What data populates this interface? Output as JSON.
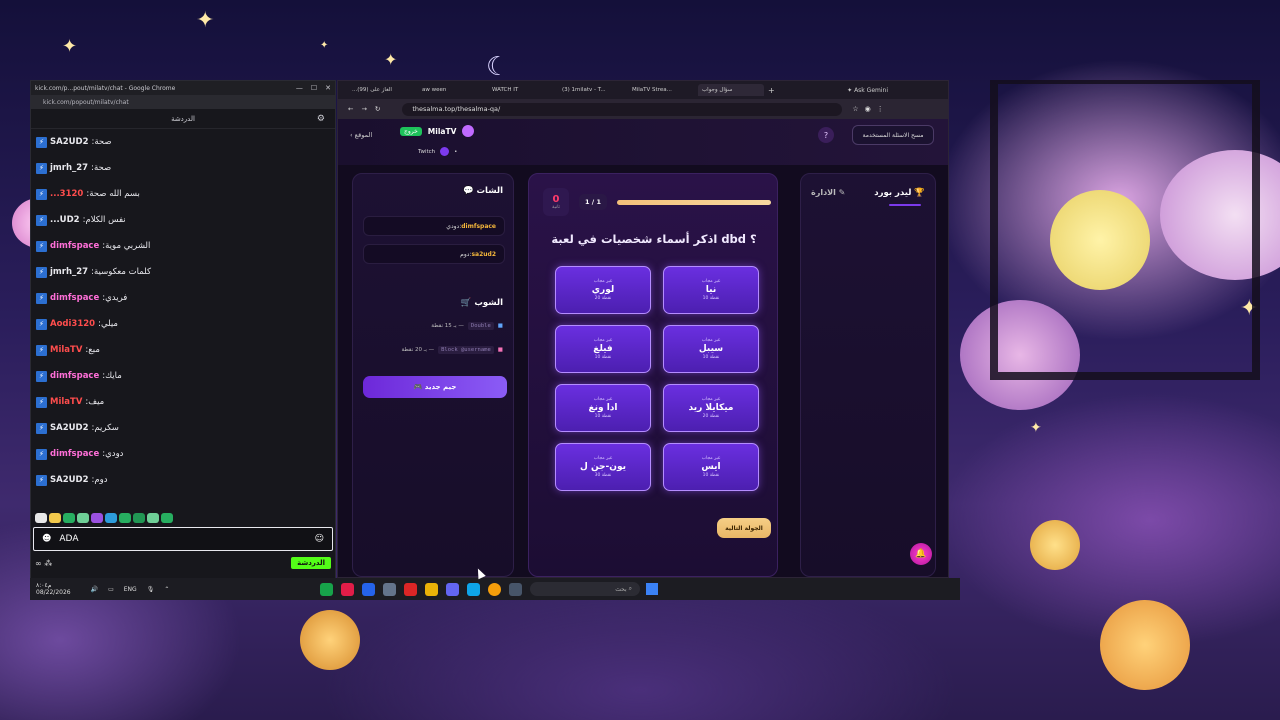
{
  "chat_window": {
    "title": "kick.com/p...pout/milatv/chat - Google Chrome",
    "address": "kick.com/popout/milatv/chat",
    "header": "الدردشة",
    "messages": [
      {
        "user": "SA2UD2",
        "text": "صحة",
        "color": "#e9e9ee"
      },
      {
        "user": "jmrh_27",
        "text": "صحة",
        "color": "#e9e9ee"
      },
      {
        "user": "...3120",
        "text": "بسم الله صحة",
        "color": "#ff4d4d"
      },
      {
        "user": "...UD2",
        "text": "نفس الكلام",
        "color": "#e9e9ee"
      },
      {
        "user": "dimfspace",
        "text": "الشربي موية",
        "color": "#ff6fd8"
      },
      {
        "user": "jmrh_27",
        "text": "كلمات معكوسية",
        "color": "#e9e9ee"
      },
      {
        "user": "dimfspace",
        "text": "فريدي",
        "color": "#ff6fd8"
      },
      {
        "user": "Aodi3120",
        "text": "ميلي",
        "color": "#ff4d4d"
      },
      {
        "user": "MilaTV",
        "text": "مبع",
        "color": "#ff4d4d"
      },
      {
        "user": "dimfspace",
        "text": "مايك",
        "color": "#ff6fd8"
      },
      {
        "user": "MilaTV",
        "text": "ميف",
        "color": "#ff4d4d"
      },
      {
        "user": "SA2UD2",
        "text": "سكريم",
        "color": "#e9e9ee"
      },
      {
        "user": "dimfspace",
        "text": "دودي",
        "color": "#ff6fd8"
      },
      {
        "user": "SA2UD2",
        "text": "دوم",
        "color": "#e9e9ee"
      }
    ],
    "input_value": "ADA",
    "send_label": "الدردشة",
    "bottom_left": "∞ ⁂"
  },
  "taskbar": {
    "time": "م٨:٠٤",
    "date": "08/22/2026",
    "lang": "ENG",
    "search_placeholder": "بحث"
  },
  "browser": {
    "tabs": [
      {
        "label": "...(99) الغاز على",
        "active": false
      },
      {
        "label": "aw ween",
        "active": false
      },
      {
        "label": "WATCH IT",
        "active": false
      },
      {
        "label": "(3) 1milatv - T...",
        "active": false
      },
      {
        "label": "MilaTV Strea...",
        "active": false
      },
      {
        "label": "سؤال وجواب",
        "active": true
      }
    ],
    "gemini": "Ask Gemini",
    "url": "thesalma.top/thesalma-qa/"
  },
  "site": {
    "clear_btn": "مسح الاسئلة المستخدمة",
    "help": "?",
    "logout": "خروج",
    "username": "MilaTV",
    "twitch": "Twitch",
    "back_link": "الموقع",
    "chat_title": "الشات",
    "chat_messages": [
      {
        "user": "dimfspace",
        "text": "دودي"
      },
      {
        "user": "sa2ud2",
        "text": "دوم"
      }
    ],
    "shop_title": "الشوب",
    "shop_items": [
      {
        "code": "Double",
        "price": "بـ 15 نقطة —"
      },
      {
        "code": "Block @username",
        "price": "بـ 20 نقطة —"
      }
    ],
    "new_game": "جيم جديد",
    "score": "0",
    "score_label": "ثانية",
    "round": "1 / 1",
    "progress": 1.0,
    "question": "اذكر أسماء شخصيات في لعبة dbd ؟",
    "answers": [
      {
        "tag": "غير مجاب",
        "name": "نيا",
        "pts": "10 نقطة"
      },
      {
        "tag": "غير مجاب",
        "name": "لوري",
        "pts": "20 نقطة"
      },
      {
        "tag": "غير مجاب",
        "name": "سيبل",
        "pts": "10 نقطة"
      },
      {
        "tag": "غير مجاب",
        "name": "فيلغ",
        "pts": "10 نقطة"
      },
      {
        "tag": "غير مجاب",
        "name": "ميكايلا ريد",
        "pts": "20 نقطة"
      },
      {
        "tag": "غير مجاب",
        "name": "ادا ونغ",
        "pts": "10 نقطة"
      },
      {
        "tag": "غير مجاب",
        "name": "ايس",
        "pts": "10 نقطة"
      },
      {
        "tag": "غير مجاب",
        "name": "يون-جن ل",
        "pts": "30 نقطة"
      }
    ],
    "next_btn": "الجولة التالية",
    "leaderboard_title": "ليدر بورد",
    "admin_link": "الادارة"
  }
}
